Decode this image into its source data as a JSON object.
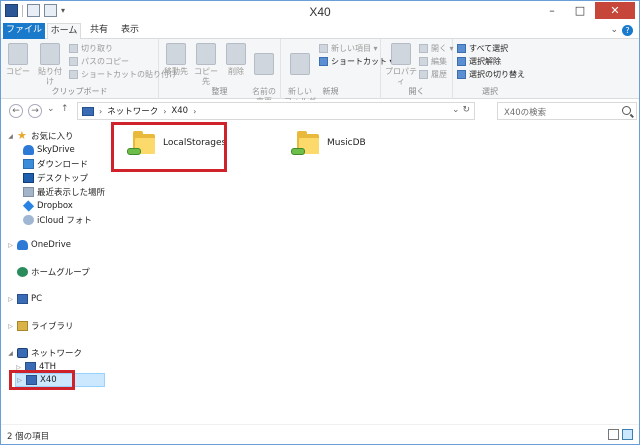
{
  "window": {
    "title": "X40"
  },
  "ribbon_tabs": {
    "file": "ファイル",
    "home": "ホーム",
    "share": "共有",
    "view": "表示"
  },
  "ribbon": {
    "clipboard": {
      "copy": "コピー",
      "paste": "貼り付け",
      "cut": "切り取り",
      "copy_path": "パスのコピー",
      "paste_shortcut": "ショートカットの貼り付け",
      "label": "クリップボード"
    },
    "organize": {
      "move_to": "移動先",
      "copy_to": "コピー先",
      "delete": "削除",
      "rename": "名前の\n変更",
      "label": "整理"
    },
    "new": {
      "new_folder": "新しい\nフォルダー",
      "new_item": "新しい項目 ▾",
      "shortcut": "ショートカット ▾",
      "label": "新規"
    },
    "open": {
      "properties": "プロパティ",
      "open": "開く ▾",
      "edit": "編集",
      "history": "履歴",
      "label": "開く"
    },
    "select": {
      "select_all": "すべて選択",
      "select_none": "選択解除",
      "invert": "選択の切り替え",
      "label": "選択"
    }
  },
  "address": {
    "crumbs": [
      "ネットワーク",
      "X40"
    ]
  },
  "search": {
    "placeholder": "X40の検索"
  },
  "nav": {
    "favorites": "お気に入り",
    "fav_items": [
      "SkyDrive",
      "ダウンロード",
      "デスクトップ",
      "最近表示した場所",
      "Dropbox",
      "iCloud フォト"
    ],
    "onedrive": "OneDrive",
    "homegroup": "ホームグループ",
    "pc": "PC",
    "library": "ライブラリ",
    "network": "ネットワーク",
    "net_items": [
      "4TH",
      "X40"
    ]
  },
  "files": [
    "LocalStorages",
    "MusicDB"
  ],
  "status": {
    "count": "2 個の項目"
  },
  "colors": {
    "accent": "#1979ca",
    "highlight": "#d0222b",
    "selected": "#cce8ff"
  }
}
